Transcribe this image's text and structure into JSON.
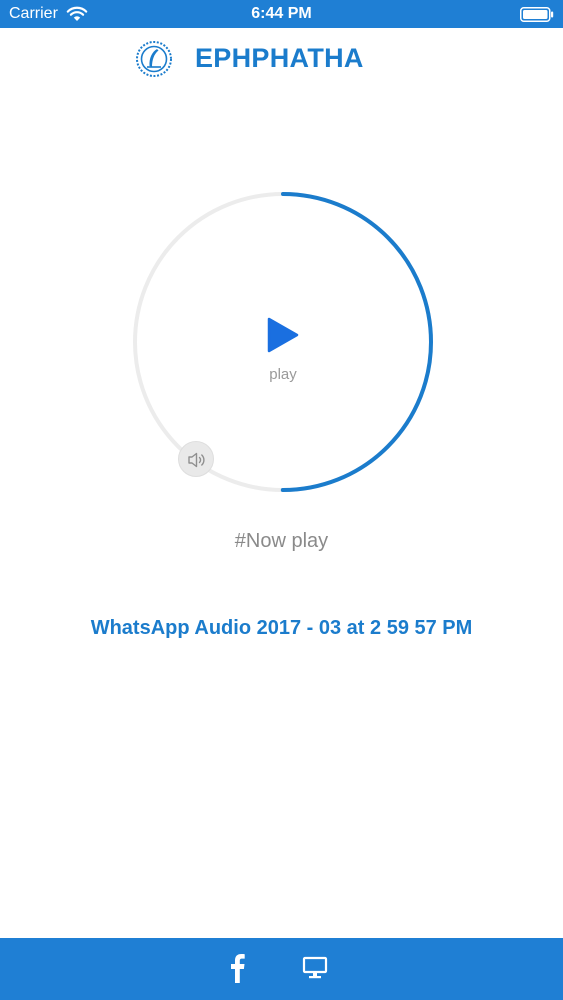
{
  "status_bar": {
    "carrier": "Carrier",
    "time": "6:44 PM",
    "icons": [
      "wifi-icon",
      "battery-icon"
    ]
  },
  "header": {
    "title": "EPHPHATHA",
    "logo_icon": "logo-icon"
  },
  "player": {
    "play_label": "play",
    "progress_fraction": 0.5,
    "icons": [
      "play-icon",
      "volume-icon"
    ]
  },
  "now_play_label": "#Now play",
  "track_title": "WhatsApp Audio 2017 - 03 at 2 59 57 PM",
  "bottom_bar": {
    "icons": [
      "facebook-icon",
      "monitor-icon"
    ]
  },
  "colors": {
    "brand_blue": "#1f7fd4",
    "title_blue": "#1b7ccc",
    "play_blue": "#1a6fe0",
    "ring_track": "#ececec",
    "muted_text": "#8a8a8a"
  }
}
